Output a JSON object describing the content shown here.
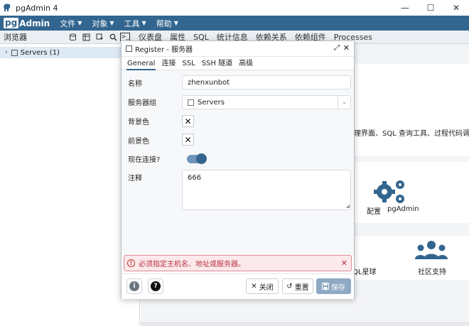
{
  "window": {
    "title": "pgAdmin 4",
    "minimize": "—",
    "maximize": "☐",
    "close": "✕"
  },
  "menubar": {
    "logo_pg": "pg",
    "logo_admin": "Admin",
    "items": [
      "文件",
      "对象",
      "工具",
      "帮助"
    ]
  },
  "toolbar": {
    "browser_label": "浏览器",
    "tabs": [
      "仪表盘",
      "属性",
      "SQL",
      "统计信息",
      "依赖关系",
      "依赖组件",
      "Processes"
    ]
  },
  "tree": {
    "servers_label": "Servers (1)"
  },
  "background": {
    "description": "理界面、SQL 查询工具、过程代码调试",
    "config_label": "配置",
    "pgadmin_label": "pgAdmin",
    "planet_label": "QL星球",
    "community_label": "社区支持"
  },
  "dialog": {
    "title": "Register - 服务器",
    "tabs": [
      "General",
      "连接",
      "SSL",
      "SSH 隧道",
      "高级"
    ],
    "active_tab": "General",
    "fields": {
      "name_label": "名称",
      "name_value": "zhenxunbot",
      "group_label": "服务器组",
      "group_value": "Servers",
      "bg_label": "背景色",
      "fg_label": "前景色",
      "connect_label": "现在连接?",
      "connect_on": true,
      "comment_label": "注释",
      "comment_value": "666"
    },
    "error": "必须指定主机名、地址或服务器。",
    "buttons": {
      "close": "关闭",
      "reset": "重置",
      "save": "保存"
    }
  },
  "colors": {
    "brand": "#326690",
    "error": "#b8303f",
    "save_disabled": "#8ea9c3"
  }
}
